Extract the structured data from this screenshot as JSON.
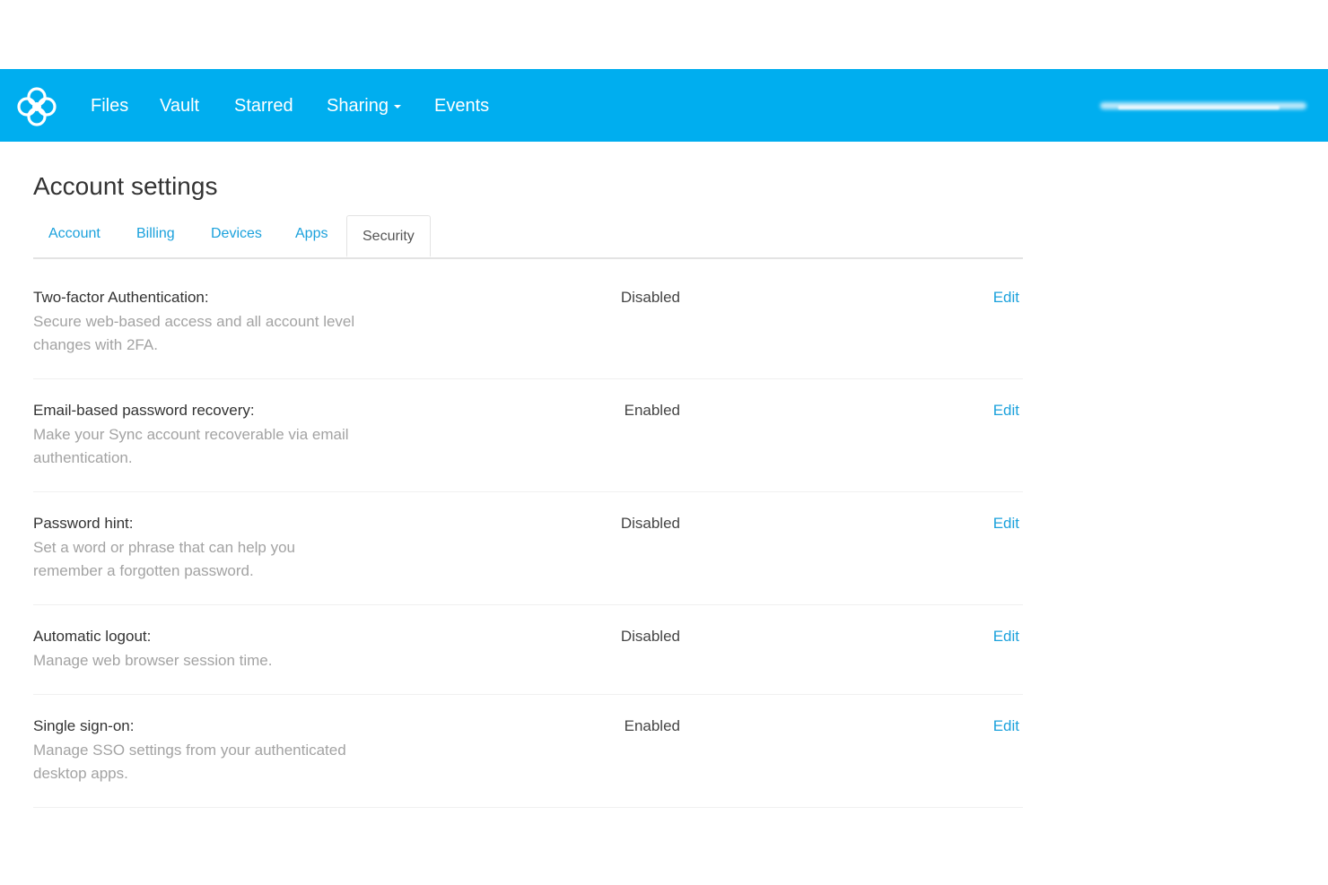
{
  "nav": {
    "items": [
      {
        "label": "Files"
      },
      {
        "label": "Vault"
      },
      {
        "label": "Starred"
      },
      {
        "label": "Sharing"
      },
      {
        "label": "Events"
      }
    ],
    "accent_color": "#00aeef"
  },
  "page": {
    "title": "Account settings"
  },
  "tabs": [
    {
      "label": "Account",
      "active": false
    },
    {
      "label": "Billing",
      "active": false
    },
    {
      "label": "Devices",
      "active": false
    },
    {
      "label": "Apps",
      "active": false
    },
    {
      "label": "Security",
      "active": true
    }
  ],
  "settings": [
    {
      "title": "Two-factor Authentication:",
      "description": "Secure web-based access and all account level changes with 2FA.",
      "status": "Disabled",
      "action": "Edit"
    },
    {
      "title": "Email-based password recovery:",
      "description": "Make your Sync account recoverable via email authentication.",
      "status": "Enabled",
      "action": "Edit"
    },
    {
      "title": "Password hint:",
      "description": "Set a word or phrase that can help you remember a forgotten password.",
      "status": "Disabled",
      "action": "Edit"
    },
    {
      "title": "Automatic logout:",
      "description": "Manage web browser session time.",
      "status": "Disabled",
      "action": "Edit"
    },
    {
      "title": "Single sign-on:",
      "description": "Manage SSO settings from your authenticated desktop apps.",
      "status": "Enabled",
      "action": "Edit"
    }
  ]
}
